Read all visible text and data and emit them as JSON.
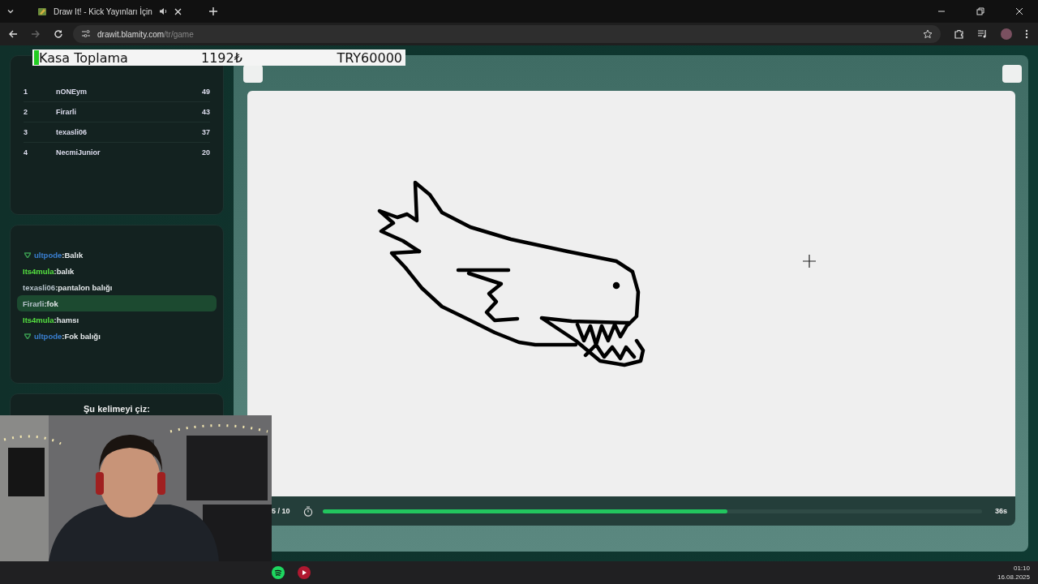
{
  "browser": {
    "tab_title": "Draw It! - Kick Yayınları İçin",
    "url_host": "drawit.blamity.com",
    "url_path": "/tr/game"
  },
  "overlay": {
    "label": "Kasa Toplama",
    "amount": "1192₺",
    "target": "TRY60000"
  },
  "leaderboard": [
    {
      "rank": "1",
      "name": "nONEym",
      "score": "49"
    },
    {
      "rank": "2",
      "name": "Firarli",
      "score": "43"
    },
    {
      "rank": "3",
      "name": "texasli06",
      "score": "37"
    },
    {
      "rank": "4",
      "name": "NecmiJunior",
      "score": "20"
    }
  ],
  "chat": [
    {
      "name": "ultpode",
      "color": "#3a7fd0",
      "badge": true,
      "message": ":Balık",
      "selected": false
    },
    {
      "name": "Its4mula",
      "color": "#55e040",
      "badge": false,
      "message": ":balık",
      "selected": false
    },
    {
      "name": "texasli06",
      "color": "#b8c4cc",
      "badge": false,
      "message": ":pantalon balığı",
      "selected": false
    },
    {
      "name": "Firarli",
      "color": "#b8c4cc",
      "badge": false,
      "message": ":fok",
      "selected": true
    },
    {
      "name": "Its4mula",
      "color": "#55e040",
      "badge": false,
      "message": ":hamsı",
      "selected": false
    },
    {
      "name": "ultpode",
      "color": "#3a7fd0",
      "badge": true,
      "message": ":Fok balığı",
      "selected": false
    }
  ],
  "word_prompt": "Şu kelimeyi çiz:",
  "game": {
    "round": "5 / 10",
    "timer": {
      "level": 0.614,
      "reading": "36s"
    }
  },
  "taskbar": {
    "time": "01:10",
    "date": "16.08.2025"
  }
}
